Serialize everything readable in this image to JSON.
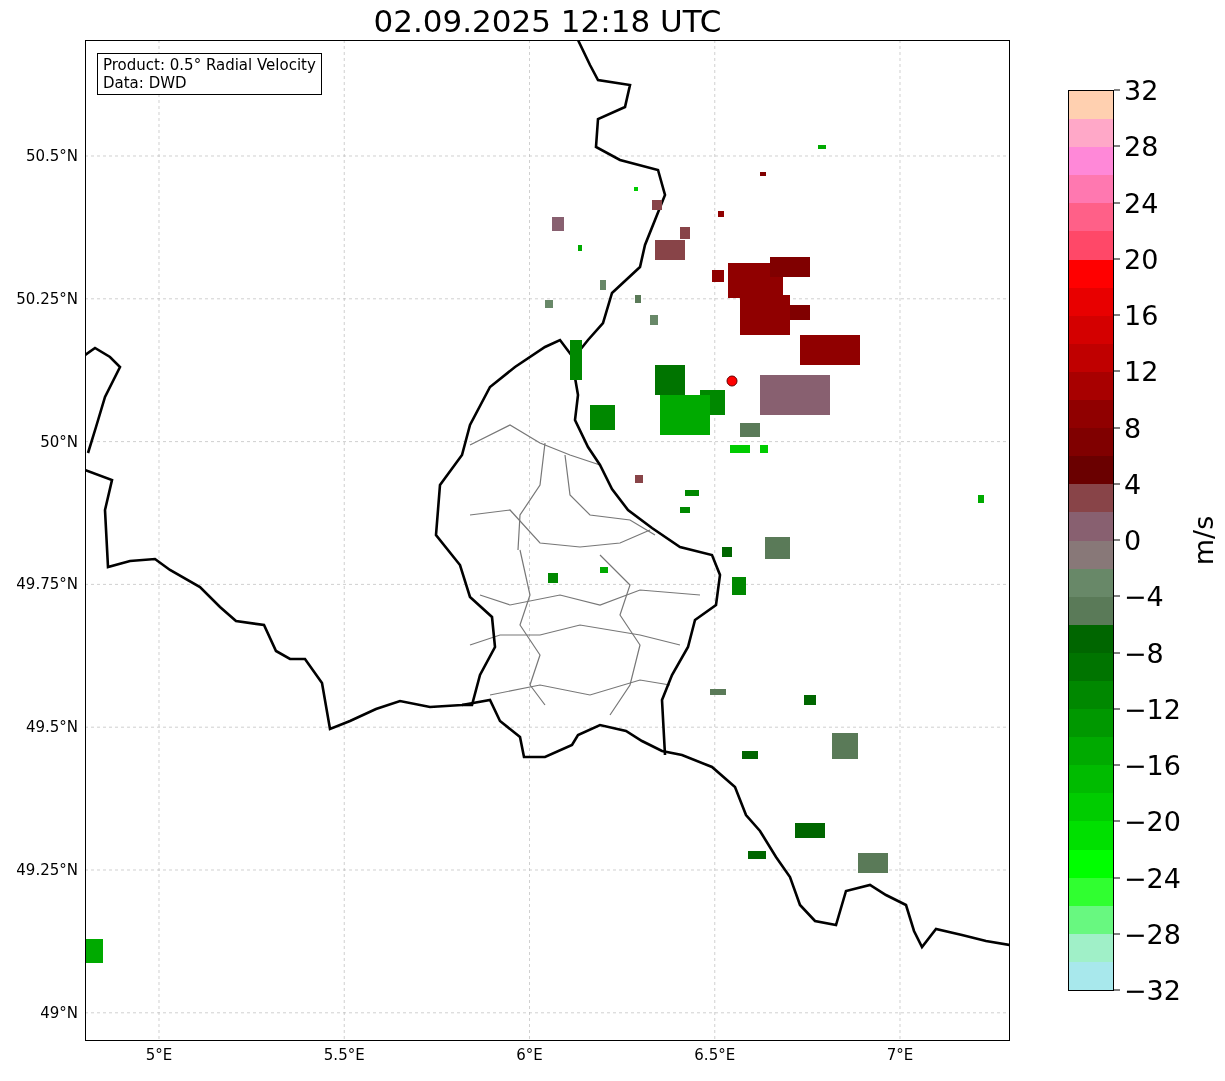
{
  "title": "02.09.2025 12:18 UTC",
  "map": {
    "info_box": [
      "Product: 0.5° Radial Velocity",
      "Data: DWD"
    ],
    "lat_ticks": [
      "50.5°N",
      "50.25°N",
      "50°N",
      "49.75°N",
      "49.5°N",
      "49.25°N",
      "49°N"
    ],
    "lon_ticks": [
      "5°E",
      "5.5°E",
      "6°E",
      "6.5°E",
      "7°E"
    ]
  },
  "colorbar": {
    "label": "m/s",
    "ticks": [
      "32",
      "28",
      "24",
      "20",
      "16",
      "12",
      "8",
      "4",
      "0",
      "−4",
      "−8",
      "−12",
      "−16",
      "−20",
      "−24",
      "−28",
      "−32"
    ],
    "segments": [
      {
        "color": "#ffd0b0"
      },
      {
        "color": "#ffa8c8"
      },
      {
        "color": "#ff88d8"
      },
      {
        "color": "#ff78b0"
      },
      {
        "color": "#ff6088"
      },
      {
        "color": "#ff4868"
      },
      {
        "color": "#ff0000"
      },
      {
        "color": "#e80000"
      },
      {
        "color": "#d40000"
      },
      {
        "color": "#c00000"
      },
      {
        "color": "#a80000"
      },
      {
        "color": "#900000"
      },
      {
        "color": "#800000"
      },
      {
        "color": "#6a0000"
      },
      {
        "color": "#884448"
      },
      {
        "color": "#886070"
      },
      {
        "color": "#887878"
      },
      {
        "color": "#688868"
      },
      {
        "color": "#5a7a58"
      },
      {
        "color": "#006600"
      },
      {
        "color": "#007400"
      },
      {
        "color": "#008800"
      },
      {
        "color": "#009800"
      },
      {
        "color": "#00aa00"
      },
      {
        "color": "#00bb00"
      },
      {
        "color": "#00cc00"
      },
      {
        "color": "#00e000"
      },
      {
        "color": "#00ff00"
      },
      {
        "color": "#30ff30"
      },
      {
        "color": "#68f880"
      },
      {
        "color": "#a0f0c8"
      },
      {
        "color": "#a8e8ec"
      }
    ]
  }
}
